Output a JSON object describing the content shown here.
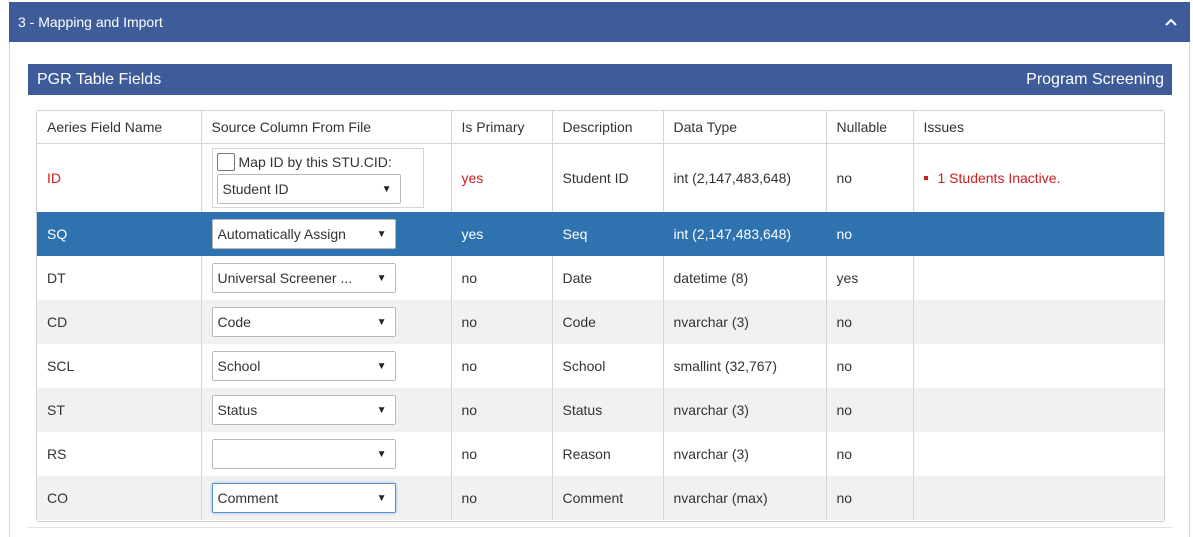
{
  "section": {
    "title": "3 - Mapping and Import"
  },
  "table_header": {
    "left": "PGR Table Fields",
    "right": "Program Screening"
  },
  "columns": [
    "Aeries Field Name",
    "Source Column From File",
    "Is Primary",
    "Description",
    "Data Type",
    "Nullable",
    "Issues"
  ],
  "id_row": {
    "field": "ID",
    "map_label": "Map ID by this STU.CID:",
    "source": "Student ID",
    "primary": "yes",
    "description": "Student ID",
    "data_type": "int (2,147,483,648)",
    "nullable": "no",
    "issue": "1 Students Inactive."
  },
  "rows": [
    {
      "field": "SQ",
      "source": "Automatically Assign",
      "primary": "yes",
      "description": "Seq",
      "data_type": "int (2,147,483,648)",
      "nullable": "no"
    },
    {
      "field": "DT",
      "source": "Universal Screener ...",
      "primary": "no",
      "description": "Date",
      "data_type": "datetime (8)",
      "nullable": "yes"
    },
    {
      "field": "CD",
      "source": "Code",
      "primary": "no",
      "description": "Code",
      "data_type": "nvarchar (3)",
      "nullable": "no"
    },
    {
      "field": "SCL",
      "source": "School",
      "primary": "no",
      "description": "School",
      "data_type": "smallint (32,767)",
      "nullable": "no"
    },
    {
      "field": "ST",
      "source": "Status",
      "primary": "no",
      "description": "Status",
      "data_type": "nvarchar (3)",
      "nullable": "no"
    },
    {
      "field": "RS",
      "source": "",
      "primary": "no",
      "description": "Reason",
      "data_type": "nvarchar (3)",
      "nullable": "no"
    },
    {
      "field": "CO",
      "source": "Comment",
      "primary": "no",
      "description": "Comment",
      "data_type": "nvarchar (max)",
      "nullable": "no"
    }
  ],
  "colors": {
    "header_bg": "#3e5c9a",
    "selected_row": "#2f72b0",
    "error_red": "#cc1f1f",
    "alt_row": "#f1f1f1"
  }
}
